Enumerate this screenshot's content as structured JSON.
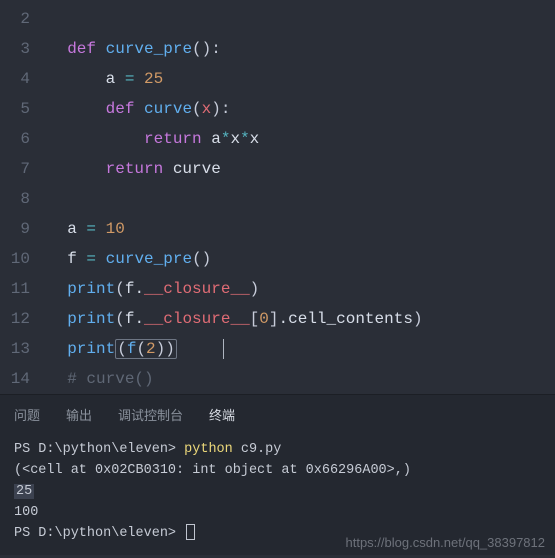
{
  "editor": {
    "line_numbers": [
      "2",
      "3",
      "4",
      "5",
      "6",
      "7",
      "8",
      "9",
      "10",
      "11",
      "12",
      "13",
      "14"
    ]
  },
  "code": {
    "def": "def",
    "return": "return",
    "fn1": "curve_pre",
    "fn2": "curve",
    "print": "print",
    "a": "a",
    "f": "f",
    "x": "x",
    "eq": "=",
    "star": "*",
    "n25": "25",
    "n10": "10",
    "n0": "0",
    "n2": "2",
    "clos": "__closure__",
    "cellc": "cell_contents",
    "cmt": "# curve()"
  },
  "tabs": {
    "problems": "问题",
    "output": "输出",
    "debug": "调试控制台",
    "terminal": "终端"
  },
  "terminal": {
    "path": "PS D:\\python\\eleven>",
    "cmd": "python",
    "arg": "c9.py",
    "l1": "(<cell at 0x02CB0310: int object at 0x66296A00>,)",
    "l2": "25",
    "l3": "100"
  },
  "watermark": "https://blog.csdn.net/qq_38397812"
}
